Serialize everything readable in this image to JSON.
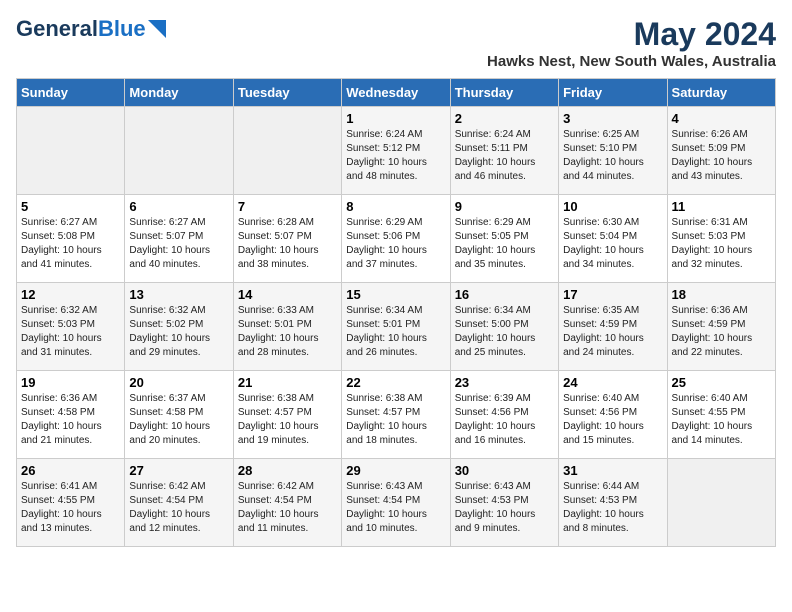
{
  "header": {
    "logo_general": "General",
    "logo_blue": "Blue",
    "month_year": "May 2024",
    "location": "Hawks Nest, New South Wales, Australia"
  },
  "weekdays": [
    "Sunday",
    "Monday",
    "Tuesday",
    "Wednesday",
    "Thursday",
    "Friday",
    "Saturday"
  ],
  "weeks": [
    [
      {
        "day": null,
        "sunrise": null,
        "sunset": null,
        "daylight": null
      },
      {
        "day": null,
        "sunrise": null,
        "sunset": null,
        "daylight": null
      },
      {
        "day": null,
        "sunrise": null,
        "sunset": null,
        "daylight": null
      },
      {
        "day": "1",
        "sunrise": "Sunrise: 6:24 AM",
        "sunset": "Sunset: 5:12 PM",
        "daylight": "Daylight: 10 hours and 48 minutes."
      },
      {
        "day": "2",
        "sunrise": "Sunrise: 6:24 AM",
        "sunset": "Sunset: 5:11 PM",
        "daylight": "Daylight: 10 hours and 46 minutes."
      },
      {
        "day": "3",
        "sunrise": "Sunrise: 6:25 AM",
        "sunset": "Sunset: 5:10 PM",
        "daylight": "Daylight: 10 hours and 44 minutes."
      },
      {
        "day": "4",
        "sunrise": "Sunrise: 6:26 AM",
        "sunset": "Sunset: 5:09 PM",
        "daylight": "Daylight: 10 hours and 43 minutes."
      }
    ],
    [
      {
        "day": "5",
        "sunrise": "Sunrise: 6:27 AM",
        "sunset": "Sunset: 5:08 PM",
        "daylight": "Daylight: 10 hours and 41 minutes."
      },
      {
        "day": "6",
        "sunrise": "Sunrise: 6:27 AM",
        "sunset": "Sunset: 5:07 PM",
        "daylight": "Daylight: 10 hours and 40 minutes."
      },
      {
        "day": "7",
        "sunrise": "Sunrise: 6:28 AM",
        "sunset": "Sunset: 5:07 PM",
        "daylight": "Daylight: 10 hours and 38 minutes."
      },
      {
        "day": "8",
        "sunrise": "Sunrise: 6:29 AM",
        "sunset": "Sunset: 5:06 PM",
        "daylight": "Daylight: 10 hours and 37 minutes."
      },
      {
        "day": "9",
        "sunrise": "Sunrise: 6:29 AM",
        "sunset": "Sunset: 5:05 PM",
        "daylight": "Daylight: 10 hours and 35 minutes."
      },
      {
        "day": "10",
        "sunrise": "Sunrise: 6:30 AM",
        "sunset": "Sunset: 5:04 PM",
        "daylight": "Daylight: 10 hours and 34 minutes."
      },
      {
        "day": "11",
        "sunrise": "Sunrise: 6:31 AM",
        "sunset": "Sunset: 5:03 PM",
        "daylight": "Daylight: 10 hours and 32 minutes."
      }
    ],
    [
      {
        "day": "12",
        "sunrise": "Sunrise: 6:32 AM",
        "sunset": "Sunset: 5:03 PM",
        "daylight": "Daylight: 10 hours and 31 minutes."
      },
      {
        "day": "13",
        "sunrise": "Sunrise: 6:32 AM",
        "sunset": "Sunset: 5:02 PM",
        "daylight": "Daylight: 10 hours and 29 minutes."
      },
      {
        "day": "14",
        "sunrise": "Sunrise: 6:33 AM",
        "sunset": "Sunset: 5:01 PM",
        "daylight": "Daylight: 10 hours and 28 minutes."
      },
      {
        "day": "15",
        "sunrise": "Sunrise: 6:34 AM",
        "sunset": "Sunset: 5:01 PM",
        "daylight": "Daylight: 10 hours and 26 minutes."
      },
      {
        "day": "16",
        "sunrise": "Sunrise: 6:34 AM",
        "sunset": "Sunset: 5:00 PM",
        "daylight": "Daylight: 10 hours and 25 minutes."
      },
      {
        "day": "17",
        "sunrise": "Sunrise: 6:35 AM",
        "sunset": "Sunset: 4:59 PM",
        "daylight": "Daylight: 10 hours and 24 minutes."
      },
      {
        "day": "18",
        "sunrise": "Sunrise: 6:36 AM",
        "sunset": "Sunset: 4:59 PM",
        "daylight": "Daylight: 10 hours and 22 minutes."
      }
    ],
    [
      {
        "day": "19",
        "sunrise": "Sunrise: 6:36 AM",
        "sunset": "Sunset: 4:58 PM",
        "daylight": "Daylight: 10 hours and 21 minutes."
      },
      {
        "day": "20",
        "sunrise": "Sunrise: 6:37 AM",
        "sunset": "Sunset: 4:58 PM",
        "daylight": "Daylight: 10 hours and 20 minutes."
      },
      {
        "day": "21",
        "sunrise": "Sunrise: 6:38 AM",
        "sunset": "Sunset: 4:57 PM",
        "daylight": "Daylight: 10 hours and 19 minutes."
      },
      {
        "day": "22",
        "sunrise": "Sunrise: 6:38 AM",
        "sunset": "Sunset: 4:57 PM",
        "daylight": "Daylight: 10 hours and 18 minutes."
      },
      {
        "day": "23",
        "sunrise": "Sunrise: 6:39 AM",
        "sunset": "Sunset: 4:56 PM",
        "daylight": "Daylight: 10 hours and 16 minutes."
      },
      {
        "day": "24",
        "sunrise": "Sunrise: 6:40 AM",
        "sunset": "Sunset: 4:56 PM",
        "daylight": "Daylight: 10 hours and 15 minutes."
      },
      {
        "day": "25",
        "sunrise": "Sunrise: 6:40 AM",
        "sunset": "Sunset: 4:55 PM",
        "daylight": "Daylight: 10 hours and 14 minutes."
      }
    ],
    [
      {
        "day": "26",
        "sunrise": "Sunrise: 6:41 AM",
        "sunset": "Sunset: 4:55 PM",
        "daylight": "Daylight: 10 hours and 13 minutes."
      },
      {
        "day": "27",
        "sunrise": "Sunrise: 6:42 AM",
        "sunset": "Sunset: 4:54 PM",
        "daylight": "Daylight: 10 hours and 12 minutes."
      },
      {
        "day": "28",
        "sunrise": "Sunrise: 6:42 AM",
        "sunset": "Sunset: 4:54 PM",
        "daylight": "Daylight: 10 hours and 11 minutes."
      },
      {
        "day": "29",
        "sunrise": "Sunrise: 6:43 AM",
        "sunset": "Sunset: 4:54 PM",
        "daylight": "Daylight: 10 hours and 10 minutes."
      },
      {
        "day": "30",
        "sunrise": "Sunrise: 6:43 AM",
        "sunset": "Sunset: 4:53 PM",
        "daylight": "Daylight: 10 hours and 9 minutes."
      },
      {
        "day": "31",
        "sunrise": "Sunrise: 6:44 AM",
        "sunset": "Sunset: 4:53 PM",
        "daylight": "Daylight: 10 hours and 8 minutes."
      },
      {
        "day": null,
        "sunrise": null,
        "sunset": null,
        "daylight": null
      }
    ]
  ]
}
